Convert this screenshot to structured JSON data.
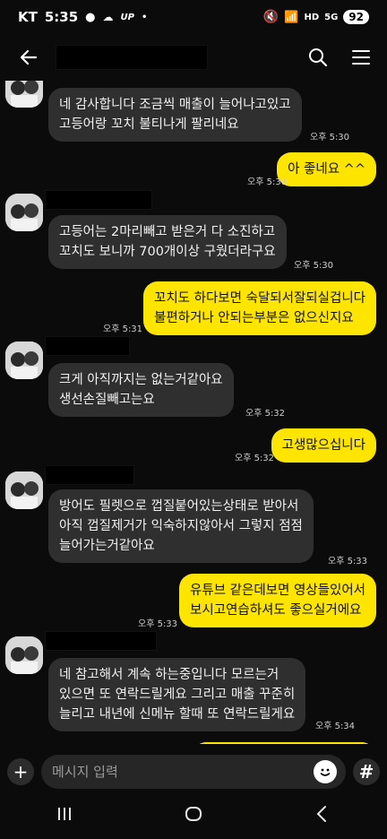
{
  "status": {
    "carrier": "KT",
    "time": "5:35",
    "up": "UP",
    "battery": "92",
    "hd": "HD",
    "signal": "5G"
  },
  "header": {
    "title": ""
  },
  "messages": [
    {
      "dir": "in",
      "lines": [
        "네 감사합니다 조금씩 매출이 늘어나고있고",
        "고등어랑 꼬치 불티나게 팔리네요"
      ],
      "time": "오후 5:30"
    },
    {
      "dir": "out",
      "lines": [
        "아 좋네요 ^^"
      ],
      "time": "오후 5:30"
    },
    {
      "dir": "in",
      "lines": [
        "고등어는 2마리빼고 받은거 다 소진하고",
        "꼬치도 보니까 700개이상 구웠더라구요"
      ],
      "time": "오후 5:30"
    },
    {
      "dir": "out",
      "lines": [
        "꼬치도 하다보면 숙달되서잘되실겁니다",
        "불편하거나 안되는부분은 없으신지요"
      ],
      "time": "오후 5:31"
    },
    {
      "dir": "in",
      "lines": [
        "크게 아직까지는 없는거같아요",
        "생선손질빼고는요"
      ],
      "time": "오후 5:32"
    },
    {
      "dir": "out",
      "lines": [
        "고생많으십니다"
      ],
      "time": "오후 5:32"
    },
    {
      "dir": "in",
      "lines": [
        "방어도 필렛으로 껍질붙어있는상태로 받아서",
        "아직 껍질제거가 익숙하지않아서 그렇지 점점",
        "늘어가는거같아요"
      ],
      "time": "오후 5:33"
    },
    {
      "dir": "out",
      "lines": [
        "유튜브 같은데보면 영상들있어서",
        "보시고연습하셔도 좋으실거에요"
      ],
      "time": "오후 5:33"
    },
    {
      "dir": "in",
      "lines": [
        "네 참고해서 계속 하는중입니다 모르는거",
        "있으면 또 연락드릴게요 그리고 매출 꾸준히",
        "늘리고 내년에 신메뉴 할때 또 연락드릴게요"
      ],
      "time": "오후 5:34"
    }
  ],
  "input": {
    "placeholder": "메시지 입력"
  },
  "colors": {
    "out_bubble": "#fee500",
    "in_bubble": "#2f2f2f",
    "background": "#0b0b0b"
  }
}
